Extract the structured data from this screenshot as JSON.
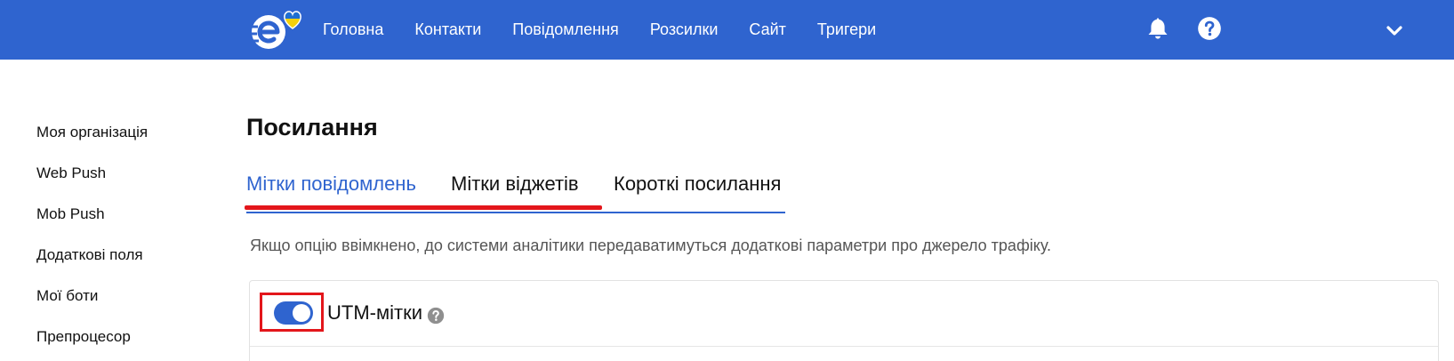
{
  "colors": {
    "brand": "#2f64cf",
    "highlight": "#e3161b",
    "flag_blue": "#1f6fd1",
    "flag_yellow": "#f5d10c"
  },
  "navbar": {
    "logo_icon": "eso-logo-with-heart",
    "links": [
      "Головна",
      "Контакти",
      "Повідомлення",
      "Розсилки",
      "Сайт",
      "Тригери"
    ],
    "icons": [
      "bell-icon",
      "help-icon",
      "chevron-down-icon"
    ]
  },
  "sidebar": {
    "items": [
      "Моя організація",
      "Web Push",
      "Mob Push",
      "Додаткові поля",
      "Мої боти",
      "Препроцесор"
    ]
  },
  "main": {
    "title": "Посилання",
    "tabs": [
      {
        "label": "Мітки повідомлень",
        "active": true
      },
      {
        "label": "Мітки віджетів",
        "active": false
      },
      {
        "label": "Короткі посилання",
        "active": false
      }
    ],
    "description": "Якщо опцію ввімкнено, до системи аналітики передаватимуться додаткові параметри про джерело трафіку.",
    "panel": {
      "label": "UTM-мітки",
      "toggle_on": true,
      "info_icon": "question-circle-icon"
    }
  }
}
